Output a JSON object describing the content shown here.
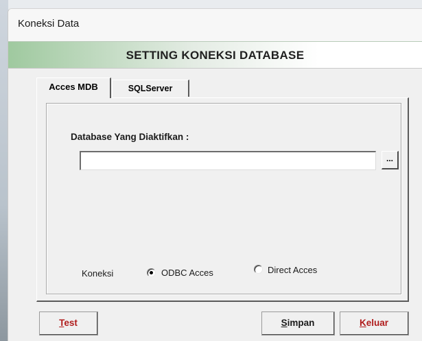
{
  "window": {
    "title": "Koneksi Data"
  },
  "header": {
    "heading": "SETTING KONEKSI DATABASE"
  },
  "tabs": [
    {
      "label": "Acces MDB",
      "active": true
    },
    {
      "label": "SQLServer",
      "active": false
    }
  ],
  "acces_mdb": {
    "database_label": "Database Yang Diaktifkan :",
    "database_value": "",
    "browse_label": "...",
    "koneksi_label": "Koneksi",
    "options": [
      {
        "label": "ODBC Acces",
        "selected": true
      },
      {
        "label": "Direct Acces",
        "selected": false
      }
    ]
  },
  "buttons": {
    "test": {
      "mnemonic": "T",
      "rest": "est"
    },
    "simpan": {
      "mnemonic": "S",
      "rest": "impan"
    },
    "keluar": {
      "mnemonic": "K",
      "rest": "eluar"
    }
  },
  "colors": {
    "header_gradient_start": "#9fc99f",
    "accent_red": "#b01c1c",
    "face": "#f0f0f0"
  }
}
